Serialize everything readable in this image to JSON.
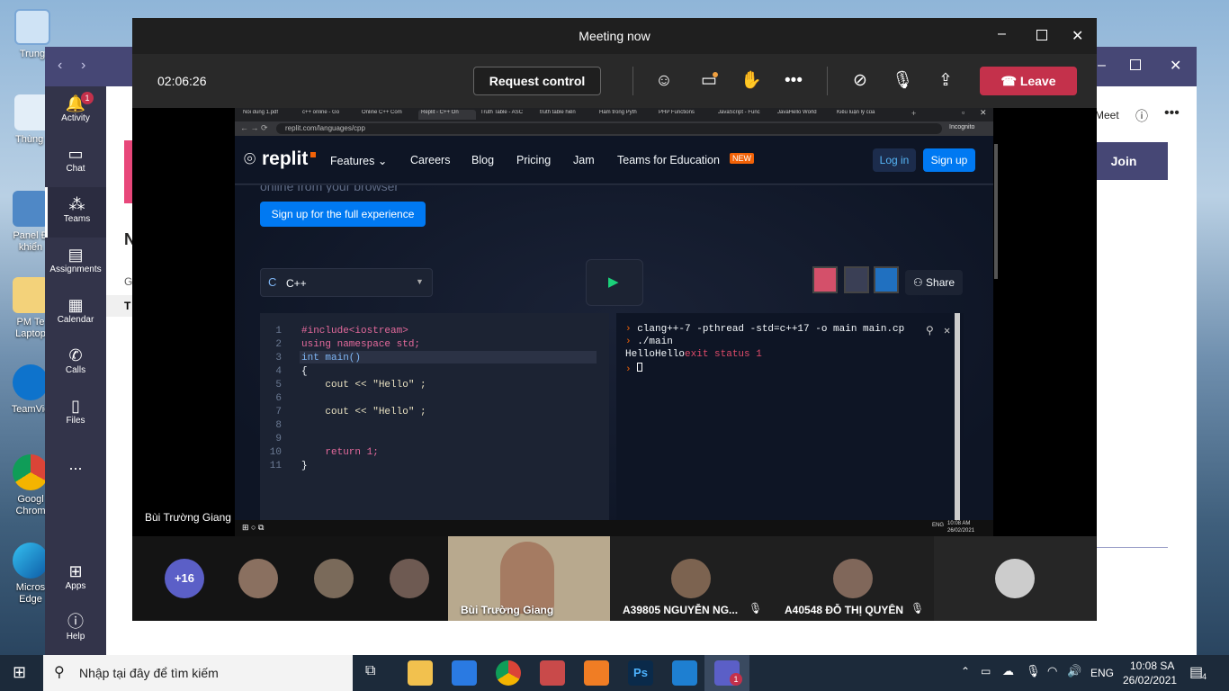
{
  "desktop_icons": [
    {
      "label": "Trung",
      "icon": "computer-icon"
    },
    {
      "label": "Thùng r",
      "icon": "recycle-bin-icon"
    },
    {
      "label": "Panel Đ\nkhiển",
      "icon": "control-panel-icon"
    },
    {
      "label": "PM Te\nLaptop",
      "icon": "folder-icon"
    },
    {
      "label": "TeamVie",
      "icon": "teamviewer-icon"
    },
    {
      "label": "Googl\nChrom",
      "icon": "chrome-icon"
    },
    {
      "label": "Micros\nEdge",
      "icon": "edge-icon"
    }
  ],
  "teams": {
    "rail": [
      {
        "label": "Activity",
        "icon": "bell-icon",
        "badge": "1"
      },
      {
        "label": "Chat",
        "icon": "chat-icon"
      },
      {
        "label": "Teams",
        "icon": "teams-icon"
      },
      {
        "label": "Assignments",
        "icon": "assignments-icon"
      },
      {
        "label": "Calendar",
        "icon": "calendar-icon"
      },
      {
        "label": "Calls",
        "icon": "phone-icon"
      },
      {
        "label": "Files",
        "icon": "file-icon"
      },
      {
        "label": "...",
        "icon": "more-icon"
      },
      {
        "label": "Apps",
        "icon": "apps-icon"
      },
      {
        "label": "Help",
        "icon": "help-icon"
      }
    ],
    "meet_label": "Meet",
    "join_label": "Join",
    "n_label": "N",
    "g_label": "G",
    "t_label": "T"
  },
  "meeting": {
    "title": "Meeting now",
    "timer": "02:06:26",
    "request_control": "Request control",
    "leave": "Leave",
    "presenter_name": "Bùi Trường Giang",
    "accent": "#c4314b"
  },
  "browser": {
    "tabs": [
      "Nối dung 1.pdf",
      "c++ online - Go",
      "Online C++ Com",
      "Replit - C++ On",
      "Truth Table - ASC",
      "truth table hiển",
      "Hàm trong Pyth",
      "PHP Functions",
      "JavaScript - Func",
      "JavaHello World",
      "Kiểu luận lý của"
    ],
    "url": "replit.com/languages/cpp",
    "incognito": "Incognito"
  },
  "replit": {
    "logo": "replit",
    "nav": [
      "Features",
      "Careers",
      "Blog",
      "Pricing",
      "Jam",
      "Teams for Education"
    ],
    "new_badge": "NEW",
    "login": "Log in",
    "signup": "Sign up",
    "hero_partial": "online from your browser",
    "signup_full": "Sign up for the full experience",
    "language": "C++",
    "share": "Share",
    "code": [
      {
        "n": "1",
        "t": "#include<iostream>"
      },
      {
        "n": "2",
        "t": "using namespace std;"
      },
      {
        "n": "3",
        "t": "int main()"
      },
      {
        "n": "4",
        "t": "{"
      },
      {
        "n": "5",
        "t": "    cout << \"Hello\" ;"
      },
      {
        "n": "6",
        "t": ""
      },
      {
        "n": "7",
        "t": "    cout << \"Hello\" ;"
      },
      {
        "n": "8",
        "t": ""
      },
      {
        "n": "9",
        "t": ""
      },
      {
        "n": "10",
        "t": "    return 1;"
      },
      {
        "n": "11",
        "t": "}"
      }
    ],
    "console": {
      "line1": "clang++-7 -pthread -std=c++17 -o main main.cp",
      "line2": "./main",
      "out_normal": "HelloHello",
      "out_error": "exit status 1"
    }
  },
  "shared_taskbar": {
    "lang": "ENG",
    "time": "10:08 AM",
    "date": "26/02/2021"
  },
  "participants": {
    "more": "+16",
    "items": [
      {
        "name": "Bùi Trường Giang",
        "video": true
      },
      {
        "name": "A39805 NGUYỄN NG...",
        "muted": true
      },
      {
        "name": "A40548 ĐỖ THỊ QUYÊN",
        "muted": true
      }
    ]
  },
  "taskbar": {
    "search_placeholder": "Nhập tại đây để tìm kiếm",
    "lang": "ENG",
    "time": "10:08 SA",
    "date": "26/02/2021",
    "notification_count": "4",
    "teams_badge": "1"
  }
}
